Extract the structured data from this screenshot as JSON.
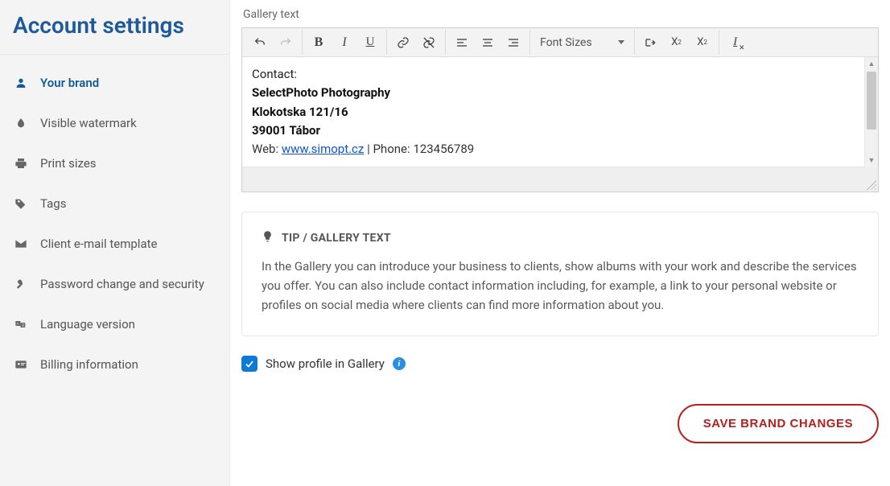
{
  "sidebar": {
    "title": "Account settings",
    "items": [
      {
        "icon": "user-icon",
        "label": "Your brand",
        "active": true
      },
      {
        "icon": "drop-icon",
        "label": "Visible watermark",
        "active": false
      },
      {
        "icon": "print-icon",
        "label": "Print sizes",
        "active": false
      },
      {
        "icon": "tags-icon",
        "label": "Tags",
        "active": false
      },
      {
        "icon": "mail-icon",
        "label": "Client e-mail template",
        "active": false
      },
      {
        "icon": "key-icon",
        "label": "Password change and security",
        "active": false
      },
      {
        "icon": "lang-icon",
        "label": "Language version",
        "active": false
      },
      {
        "icon": "card-icon",
        "label": "Billing information",
        "active": false
      }
    ]
  },
  "editor": {
    "label": "Gallery text",
    "font_sizes_label": "Font Sizes",
    "content": {
      "contact_label": "Contact:",
      "line1": "SelectPhoto Photography",
      "line2": "Klokotska 121/16",
      "line3": "39001 Tábor",
      "web_label": "Web: ",
      "web_url_text": "www.simopt.cz",
      "phone_sep": " | Phone: ",
      "phone": "123456789"
    }
  },
  "tip": {
    "heading": "TIP / GALLERY TEXT",
    "body": "In the Gallery you can introduce your business to clients, show albums with your work and describe the services you offer. You can also include contact information including, for example, a link to your personal website or profiles on social media where clients can find more information about you."
  },
  "checkbox": {
    "label": "Show profile in Gallery",
    "checked": true
  },
  "actions": {
    "save_label": "SAVE BRAND CHANGES"
  }
}
